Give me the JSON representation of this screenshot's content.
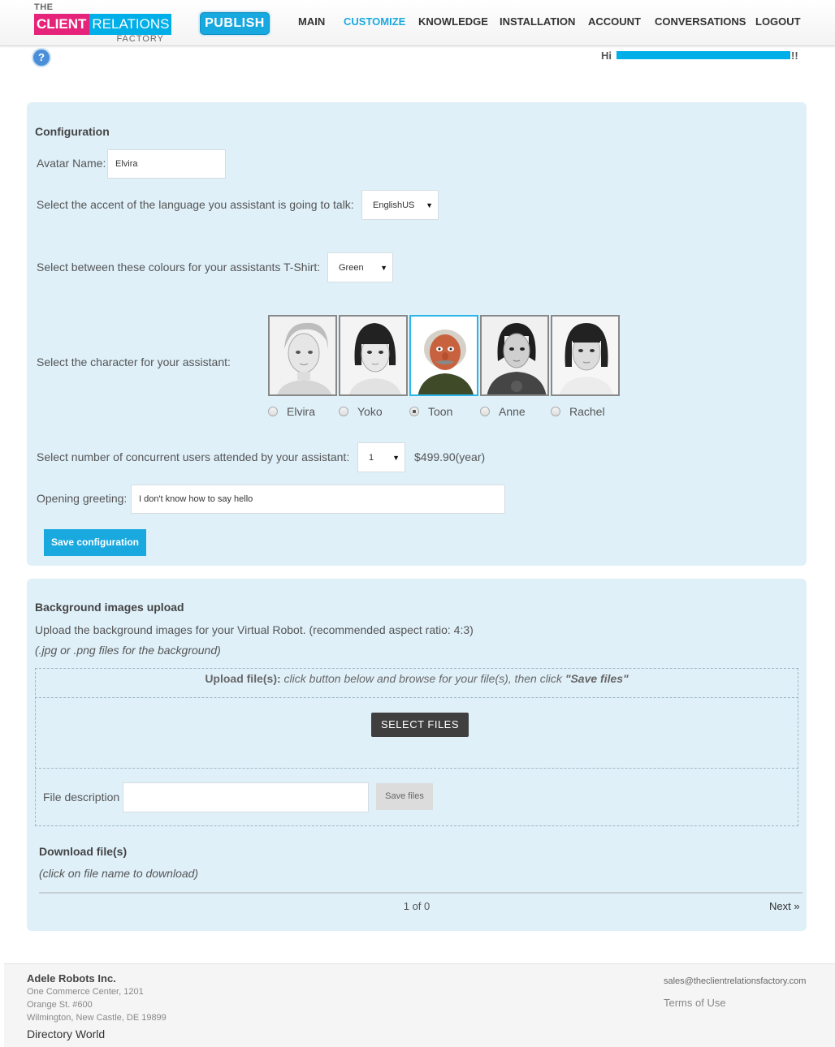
{
  "header": {
    "logo": {
      "the": "THE",
      "client": "CLIENT",
      "relations": "RELATIONS",
      "factory": "FACTORY"
    },
    "publish_label": "PUBLISH",
    "nav": [
      {
        "label": "MAIN",
        "active": false
      },
      {
        "label": "CUSTOMIZE",
        "active": true
      },
      {
        "label": "KNOWLEDGE",
        "active": false
      },
      {
        "label": "INSTALLATION",
        "active": false
      },
      {
        "label": "ACCOUNT",
        "active": false
      },
      {
        "label": "CONVERSATIONS",
        "active": false
      },
      {
        "label": "LOGOUT",
        "active": false
      }
    ],
    "help_icon": "question-circle-icon",
    "help_glyph": "?",
    "greeting_prefix": "Hi",
    "greeting_suffix": "!!"
  },
  "config": {
    "title": "Configuration",
    "avatar_name_label": "Avatar Name:",
    "avatar_name_value": "Elvira",
    "accent_label": "Select the accent of the language you assistant is going to talk:",
    "accent_value": "EnglishUS",
    "tshirt_label": "Select between these colours for your assistants T-Shirt:",
    "tshirt_value": "Green",
    "character_label": "Select the character for your assistant:",
    "characters": [
      {
        "name": "Elvira",
        "selected": false
      },
      {
        "name": "Yoko",
        "selected": false
      },
      {
        "name": "Toon",
        "selected": true
      },
      {
        "name": "Anne",
        "selected": false
      },
      {
        "name": "Rachel",
        "selected": false
      }
    ],
    "users_label": "Select number of concurrent users attended by your assistant:",
    "users_value": "1",
    "price": "$499.90(year)",
    "greeting_label": "Opening greeting:",
    "greeting_value": "I don't know how to say hello",
    "save_label": "Save configuration"
  },
  "upload": {
    "title": "Background images upload",
    "description": "Upload the background images for your Virtual Robot. (recommended aspect ratio: 4:3)",
    "hint": "(.jpg or .png files for the background)",
    "upload_bold": "Upload file(s):",
    "upload_text": " click button below and browse for your file(s), then click ",
    "upload_quote": "\"Save files\"",
    "select_files_label": "SELECT FILES",
    "file_description_label": "File description",
    "file_description_value": "",
    "save_files_label": "Save files",
    "download_title": "Download file(s)",
    "download_hint": "(click on file name to download)",
    "pagination": "1 of 0",
    "next_label": "Next »"
  },
  "footer": {
    "company": "Adele Robots Inc.",
    "address1": "One Commerce Center, 1201",
    "address2": "Orange St. #600",
    "address3": "Wilmington, New Castle, DE 19899",
    "directory_link": "Directory World",
    "email": "sales@theclientrelationsfactory.com",
    "terms": "Terms of Use"
  },
  "colors": {
    "accent": "#1aa9df",
    "brand_pink": "#e6237a",
    "brand_blue": "#00aee8",
    "panel_bg": "#dff0f9"
  }
}
